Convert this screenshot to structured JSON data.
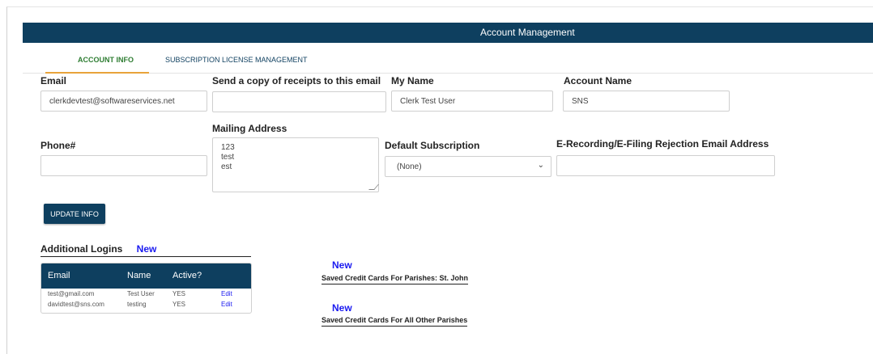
{
  "header": {
    "title": "Account Management"
  },
  "tabs": [
    {
      "label": "ACCOUNT INFO"
    },
    {
      "label": "SUBSCRIPTION LICENSE MANAGEMENT"
    }
  ],
  "form": {
    "email": {
      "label": "Email",
      "value": "clerkdevtest@softwareservices.net"
    },
    "receipts": {
      "label": "Send a copy of receipts to this email",
      "value": ""
    },
    "my_name": {
      "label": "My Name",
      "value": "Clerk Test User"
    },
    "account_name": {
      "label": "Account Name",
      "value": "SNS"
    },
    "phone": {
      "label": "Phone#",
      "value": ""
    },
    "mailing_address": {
      "label": "Mailing Address",
      "value": "123\ntest\nest"
    },
    "default_subscription": {
      "label": "Default Subscription",
      "value": "(None)"
    },
    "rejection_email": {
      "label": "E-Recording/E-Filing Rejection Email Address",
      "value": ""
    },
    "update_button": "UPDATE INFO"
  },
  "additional_logins": {
    "title": "Additional Logins",
    "new_label": "New",
    "columns": [
      "Email",
      "Name",
      "Active?"
    ],
    "rows": [
      {
        "email": "test@gmail.com",
        "name": "Test User",
        "active": "YES",
        "action": "Edit"
      },
      {
        "email": "davidtest@sns.com",
        "name": "testing",
        "active": "YES",
        "action": "Edit"
      }
    ]
  },
  "credit_cards": [
    {
      "new_label": "New",
      "title": "Saved Credit Cards For Parishes: St. John"
    },
    {
      "new_label": "New",
      "title": "Saved Credit Cards For All Other Parishes"
    }
  ],
  "colors": {
    "header_bg": "#0e3f5f",
    "active_tab": "#2e7d32",
    "tab_underline": "#e8a33a",
    "link": "#1a1af0"
  }
}
